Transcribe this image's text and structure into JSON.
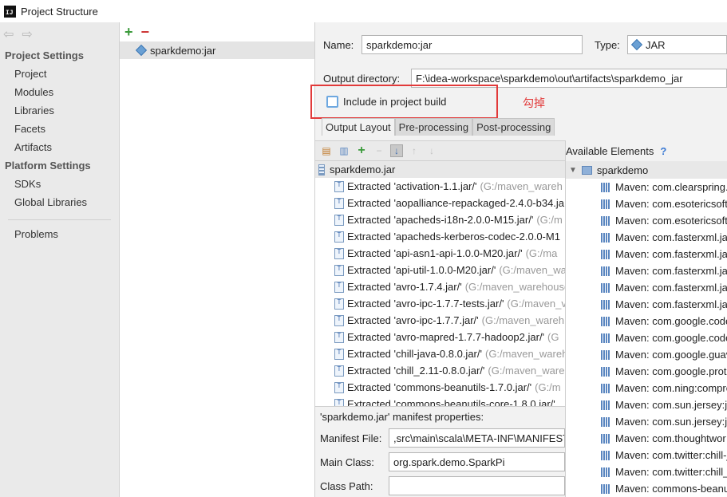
{
  "window": {
    "title": "Project Structure",
    "icon": "intellij-icon"
  },
  "sidebar": {
    "project_settings_header": "Project Settings",
    "project_settings_items": [
      "Project",
      "Modules",
      "Libraries",
      "Facets",
      "Artifacts"
    ],
    "platform_settings_header": "Platform Settings",
    "platform_settings_items": [
      "SDKs",
      "Global Libraries"
    ],
    "problems": "Problems"
  },
  "artifacts": {
    "items": [
      "sparkdemo:jar"
    ]
  },
  "config": {
    "name_label": "Name:",
    "name_value": "sparkdemo:jar",
    "type_label": "Type:",
    "type_value": "JAR",
    "output_dir_label": "Output directory:",
    "output_dir_value": "F:\\idea-workspace\\sparkdemo\\out\\artifacts\\sparkdemo_jar",
    "include_label": "Include in project build",
    "include_checked": false,
    "annotation": "勾掉",
    "tabs": [
      "Output Layout",
      "Pre-processing",
      "Post-processing"
    ],
    "active_tab": "Output Layout"
  },
  "layout_tree": {
    "root": "sparkdemo.jar",
    "rows": [
      {
        "name": "Extracted 'activation-1.1.jar/'",
        "path": " (G:/maven_wareh"
      },
      {
        "name": "Extracted 'aopalliance-repackaged-2.4.0-b34.ja",
        "path": ""
      },
      {
        "name": "Extracted 'apacheds-i18n-2.0.0-M15.jar/'",
        "path": " (G:/m"
      },
      {
        "name": "Extracted 'apacheds-kerberos-codec-2.0.0-M1",
        "path": ""
      },
      {
        "name": "Extracted 'api-asn1-api-1.0.0-M20.jar/'",
        "path": " (G:/ma"
      },
      {
        "name": "Extracted 'api-util-1.0.0-M20.jar/'",
        "path": " (G:/maven_wa"
      },
      {
        "name": "Extracted 'avro-1.7.4.jar/'",
        "path": " (G:/maven_warehouse"
      },
      {
        "name": "Extracted 'avro-ipc-1.7.7-tests.jar/'",
        "path": " (G:/maven_v"
      },
      {
        "name": "Extracted 'avro-ipc-1.7.7.jar/'",
        "path": " (G:/maven_wareh"
      },
      {
        "name": "Extracted 'avro-mapred-1.7.7-hadoop2.jar/'",
        "path": " (G"
      },
      {
        "name": "Extracted 'chill-java-0.8.0.jar/'",
        "path": " (G:/maven_wareh"
      },
      {
        "name": "Extracted 'chill_2.11-0.8.0.jar/'",
        "path": " (G:/maven_wareh"
      },
      {
        "name": "Extracted 'commons-beanutils-1.7.0.jar/'",
        "path": " (G:/m"
      },
      {
        "name": "Extracted 'commons-beanutils-core-1.8.0.jar/'",
        "path": ""
      }
    ]
  },
  "manifest": {
    "title": "'sparkdemo.jar' manifest properties:",
    "file_label": "Manifest File:",
    "file_value": ",src\\main\\scala\\META-INF\\MANIFEST",
    "main_class_label": "Main Class:",
    "main_class_value": "org.spark.demo.SparkPi",
    "class_path_label": "Class Path:",
    "class_path_value": ""
  },
  "available": {
    "title": "Available Elements",
    "help": "?",
    "root": "sparkdemo",
    "items": [
      "Maven: com.clearspring.",
      "Maven: com.esotericsoft",
      "Maven: com.esotericsoft",
      "Maven: com.fasterxml.jac",
      "Maven: com.fasterxml.jac",
      "Maven: com.fasterxml.jac",
      "Maven: com.fasterxml.jac",
      "Maven: com.fasterxml.jac",
      "Maven: com.google.code",
      "Maven: com.google.code",
      "Maven: com.google.guav",
      "Maven: com.google.prot",
      "Maven: com.ning:compre",
      "Maven: com.sun.jersey:je",
      "Maven: com.sun.jersey:je",
      "Maven: com.thoughtwor",
      "Maven: com.twitter:chill-j",
      "Maven: com.twitter:chill_2",
      "Maven: commons-beanu"
    ]
  }
}
